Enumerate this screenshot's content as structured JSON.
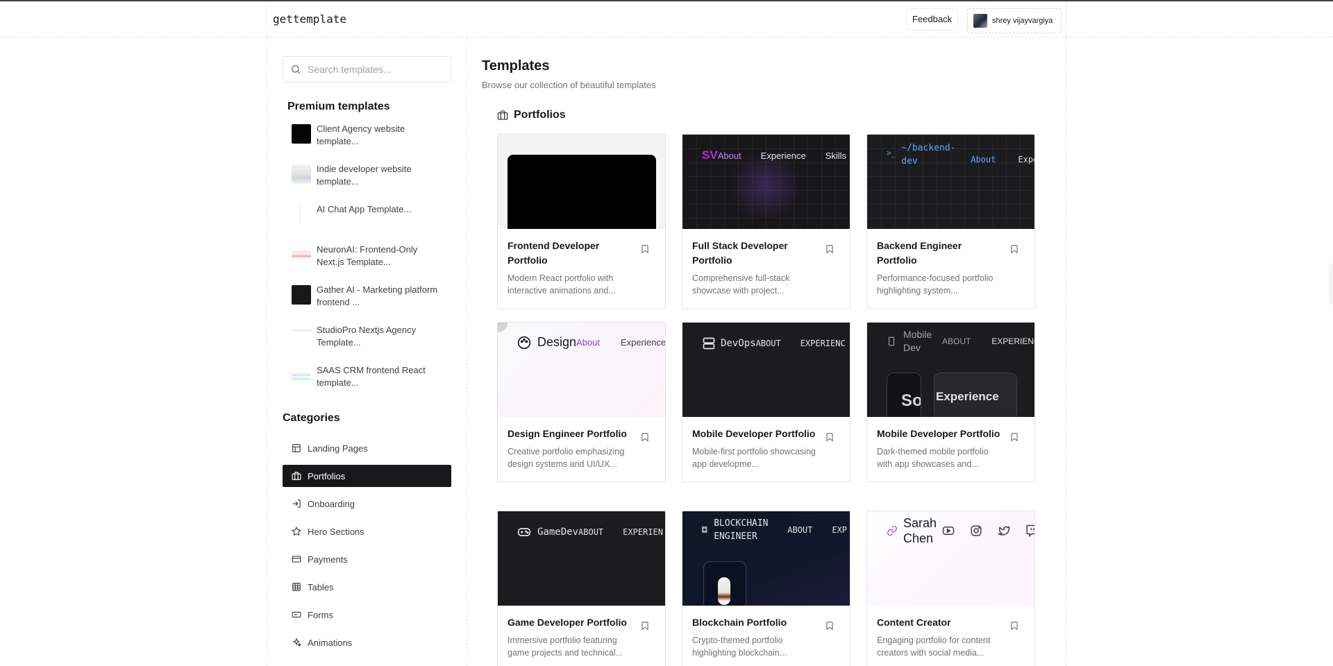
{
  "header": {
    "logo": "gettemplate",
    "feedback_label": "Feedback",
    "user_name": "shrey vijayvargiya"
  },
  "search": {
    "placeholder": "Search templates..."
  },
  "premium": {
    "title": "Premium templates",
    "items": [
      {
        "label": "Client Agency website template..."
      },
      {
        "label": "Indie developer website template..."
      },
      {
        "label": "AI Chat App Template..."
      },
      {
        "label": "NeuronAI: Frontend-Only Next.js Template..."
      },
      {
        "label": "Gather AI - Marketing platform frontend ..."
      },
      {
        "label": "StudioPro Nextjs Agency Template..."
      },
      {
        "label": "SAAS CRM frontend React template..."
      }
    ]
  },
  "categories": {
    "title": "Categories",
    "items": [
      {
        "label": "Landing Pages",
        "icon": "layout-icon"
      },
      {
        "label": "Portfolios",
        "icon": "briefcase-icon"
      },
      {
        "label": "Onboarding",
        "icon": "login-icon"
      },
      {
        "label": "Hero Sections",
        "icon": "star-icon"
      },
      {
        "label": "Payments",
        "icon": "credit-card-icon"
      },
      {
        "label": "Tables",
        "icon": "table-icon"
      },
      {
        "label": "Forms",
        "icon": "form-icon"
      },
      {
        "label": "Animations",
        "icon": "sparkles-icon"
      }
    ]
  },
  "main": {
    "title": "Templates",
    "subtitle": "Browse our collection of beautiful templates",
    "section_title": "Portfolios"
  },
  "cards": [
    {
      "title": "Frontend Developer Portfolio",
      "desc": "Modern React portfolio with interactive animations and..."
    },
    {
      "title": "Full Stack Developer Portfolio",
      "desc": "Comprehensive full-stack showcase with project...",
      "preview": {
        "brand": "SV",
        "nav": [
          "About",
          "Experience",
          "Skills"
        ]
      }
    },
    {
      "title": "Backend Engineer Portfolio",
      "desc": "Performance-focused portfolio highlighting system...",
      "preview": {
        "brand_line1": "~/backend-",
        "brand_line2": "dev",
        "nav": [
          "About",
          "Exper"
        ]
      }
    },
    {
      "title": "Design Engineer Portfolio",
      "desc": "Creative portfolio emphasizing design systems and UI/UX...",
      "preview": {
        "brand": "Design",
        "nav": [
          "About",
          "Experience"
        ]
      }
    },
    {
      "title": "Mobile Developer Portfolio",
      "desc": "Mobile-first portfolio showcasing app developme...",
      "preview": {
        "brand": "DevOps",
        "nav": [
          "ABOUT",
          "EXPERIENC"
        ]
      }
    },
    {
      "title": "Mobile Developer Portfolio",
      "desc": "Dark-themed mobile portfolio with app showcases and...",
      "preview": {
        "brand_line1": "Mobile",
        "brand_line2": "Dev",
        "nav": [
          "ABOUT",
          "EXPERIENC"
        ],
        "big1": "Sof",
        "big2": "Experience"
      }
    },
    {
      "title": "Game Developer Portfolio",
      "desc": "Immersive portfolio featuring game projects and technical...",
      "preview": {
        "brand": "GameDev",
        "nav": [
          "ABOUT",
          "EXPERIEN"
        ]
      }
    },
    {
      "title": "Blockchain Portfolio",
      "desc": "Crypto-themed portfolio highlighting blockchain...",
      "preview": {
        "brand_line1": "BLOCKCHAIN",
        "brand_line2": "ENGINEER",
        "nav": [
          "ABOUT",
          "EXP"
        ]
      }
    },
    {
      "title": "Content Creator",
      "desc": "Engaging portfolio for content creators with social media...",
      "preview": {
        "brand_line1": "Sarah",
        "brand_line2": "Chen"
      }
    }
  ]
}
